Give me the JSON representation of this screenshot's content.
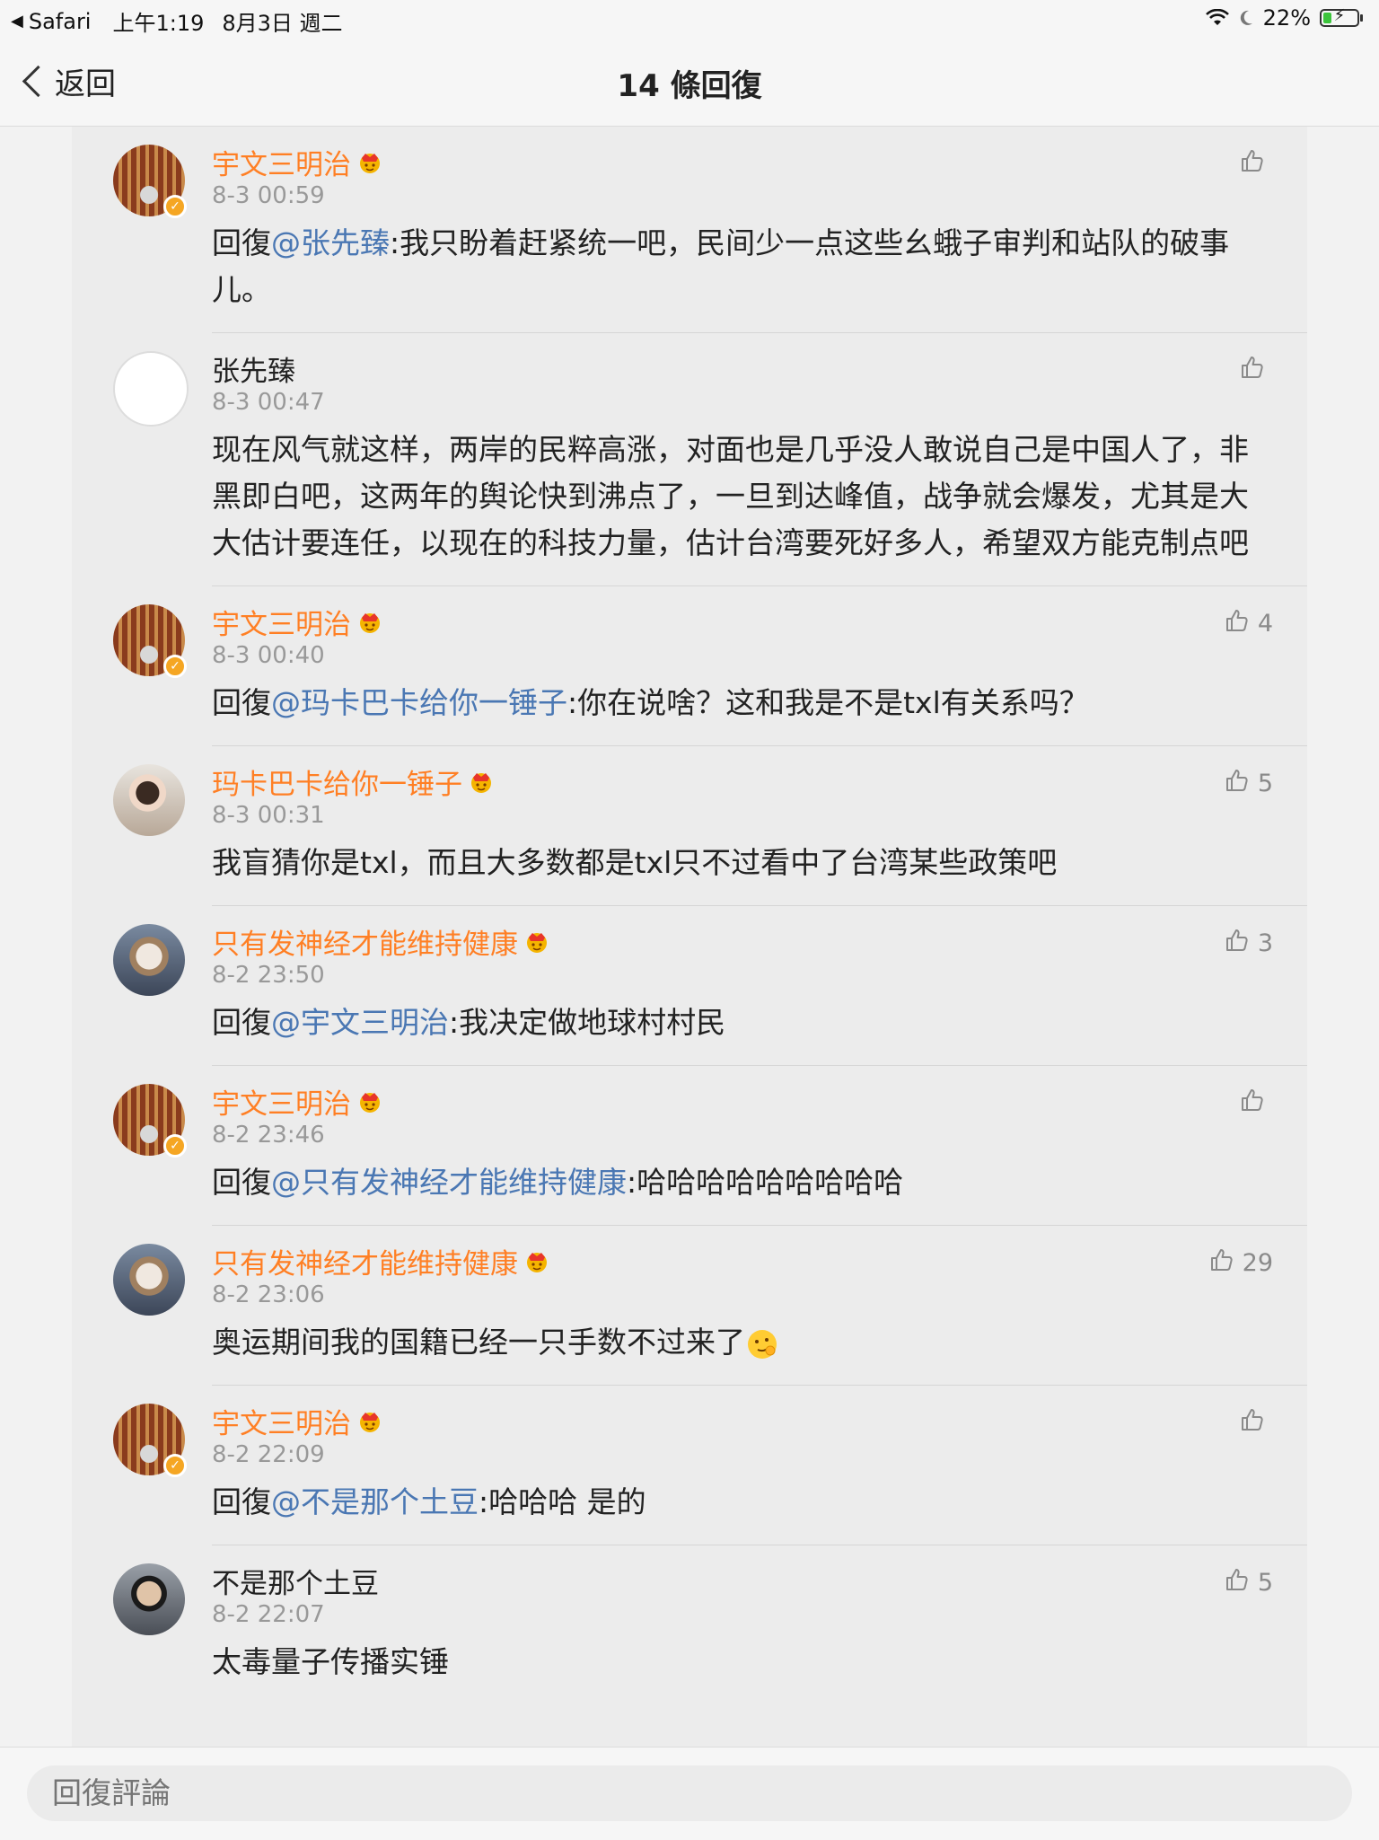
{
  "status_bar": {
    "back_app": "Safari",
    "time": "上午1:19",
    "date": "8月3日 週二",
    "battery": "22%"
  },
  "nav": {
    "back_label": "返回",
    "title": "14 條回復"
  },
  "comments": [
    {
      "user": "宇文三明治",
      "vip": true,
      "verified": true,
      "time": "8-3 00:59",
      "likes": "",
      "prefix": "回復",
      "mention": "@张先臻",
      "text": ":我只盼着赶紧统一吧，民间少一点这些幺蛾子审判和站队的破事儿。"
    },
    {
      "user": "张先臻",
      "vip": false,
      "verified": false,
      "time": "8-3 00:47",
      "likes": "",
      "prefix": "",
      "mention": "",
      "text": "现在风气就这样，两岸的民粹高涨，对面也是几乎没人敢说自己是中国人了，非黑即白吧，这两年的舆论快到沸点了，一旦到达峰值，战争就会爆发，尤其是大大估计要连任，以现在的科技力量，估计台湾要死好多人，希望双方能克制点吧"
    },
    {
      "user": "宇文三明治",
      "vip": true,
      "verified": true,
      "time": "8-3 00:40",
      "likes": "4",
      "prefix": "回復",
      "mention": "@玛卡巴卡给你一锤子",
      "text": ":你在说啥？这和我是不是txl有关系吗？"
    },
    {
      "user": "玛卡巴卡给你一锤子",
      "vip": true,
      "verified": false,
      "time": "8-3 00:31",
      "likes": "5",
      "prefix": "",
      "mention": "",
      "text": "我盲猜你是txl，而且大多数都是txl只不过看中了台湾某些政策吧"
    },
    {
      "user": "只有发神经才能维持健康",
      "vip": true,
      "verified": false,
      "time": "8-2 23:50",
      "likes": "3",
      "prefix": "回復",
      "mention": "@宇文三明治",
      "text": ":我决定做地球村村民"
    },
    {
      "user": "宇文三明治",
      "vip": true,
      "verified": true,
      "time": "8-2 23:46",
      "likes": "",
      "prefix": "回復",
      "mention": "@只有发神经才能维持健康",
      "text": ":哈哈哈哈哈哈哈哈哈"
    },
    {
      "user": "只有发神经才能维持健康",
      "vip": true,
      "verified": false,
      "time": "8-2 23:06",
      "likes": "29",
      "prefix": "",
      "mention": "",
      "text": "奥运期间我的国籍已经一只手数不过来了"
    },
    {
      "user": "宇文三明治",
      "vip": true,
      "verified": true,
      "time": "8-2 22:09",
      "likes": "",
      "prefix": "回復",
      "mention": "@不是那个土豆",
      "text": ":哈哈哈 是的"
    },
    {
      "user": "不是那个土豆",
      "vip": false,
      "verified": false,
      "time": "8-2 22:07",
      "likes": "5",
      "prefix": "",
      "mention": "",
      "text": "太毒量子传播实锤"
    }
  ],
  "reply_box": {
    "placeholder": "回復評論"
  },
  "colors": {
    "vip_name": "#ff7f24",
    "mention": "#4a77b3",
    "verified_badge": "#f5a623",
    "battery_fill": "#3cc43c"
  }
}
